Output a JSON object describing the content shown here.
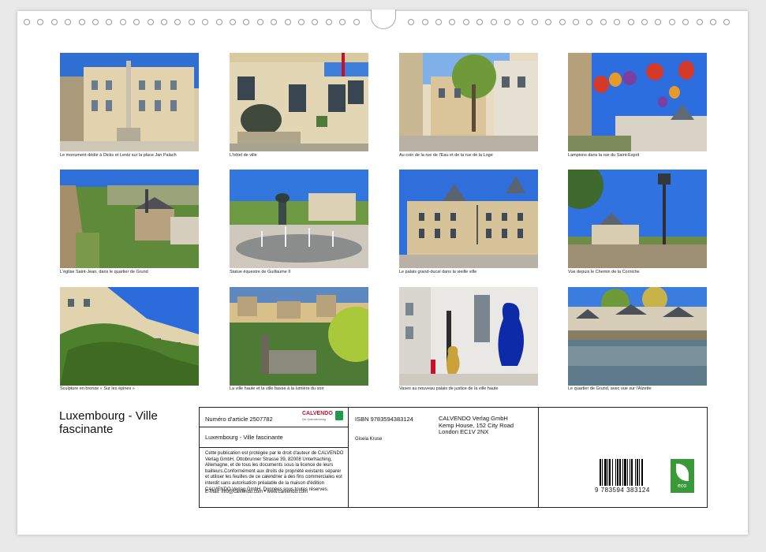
{
  "captions": [
    "Le monument dédié à Dicks et Lentz sur la place Jan Palach",
    "L'hôtel de ville",
    "Au coin de la rue de l'Eau et de la rue de la Loge",
    "Lampions dans la rue du Saint-Esprit",
    "L'église Saint-Jean, dans le quartier de Grund",
    "Statue équestre de Guillaume II",
    "Le palais grand-ducal dans la vieille ville",
    "Vue depuis le Chemin de la Corniche",
    "Sculpture en bronze « Sur les épines »",
    "La ville haute et la ville basse à la lumière du soir",
    "Vases au nouveau palais de justice de la ville haute",
    "Le quartier de Grund, avec vue sur l'Alzette"
  ],
  "title": "Luxembourg - Ville fascinante",
  "article": "Numéro d'article 2507782",
  "calvendo_logo": "CALVENDO",
  "calvendo_sub": "Der Kalenderverlag",
  "subtitle": "Luxembourg - Ville fascinante",
  "legal": "Cette publication est protégée par le droit d'auteur de CALVENDO Verlag GmbH, Ottobrunner Strasse 39, 82008 Unterhaching,  Allemagne, et de tous les documents sous la licence de leurs bailleurs.Conformément aux droits de propriété existants séparer et utiliser les feuilles de ce calendrier à des fins commerciales est interdit sans autorisation préalable de la maison d'édition  CALVENDO Verlag GmbH. Données sous toutes réserves.",
  "email": "E-Mail: info@calvendo.com • www.calvendo.com",
  "isbn": "ISBN 9783594383124",
  "publisher": [
    "CALVENDO Verlag GmbH",
    "Kemp House, 152 City Road",
    "London EC1V 2NX"
  ],
  "author": "Gisela Kruse",
  "barcode_number": "9 783594 383124",
  "eco_label": "eco",
  "colors": {
    "sky": "#2f74d6",
    "calvendo_green": "#1f9a4a",
    "calvendo_red": "#c8102e"
  }
}
